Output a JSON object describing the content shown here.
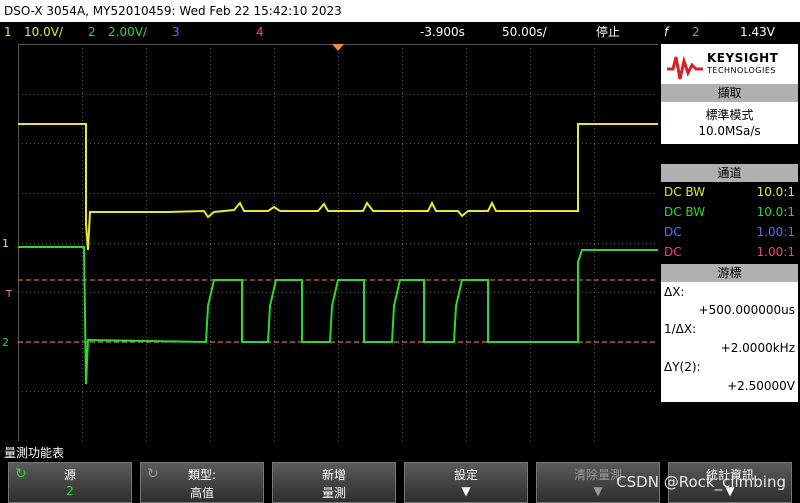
{
  "title": "DSO-X 3054A, MY52010459: Wed Feb 22 15:42:10 2023",
  "status": {
    "ch1_num": "1",
    "ch1_scale": "10.0V/",
    "ch2_num": "2",
    "ch2_scale": "2.00V/",
    "ch3_num": "3",
    "ch4_num": "4",
    "time_offset": "-3.900s",
    "time_scale": "50.00s/",
    "run_state": "停止",
    "trigger_slope": "f",
    "trigger_channel": "2",
    "trigger_level": "1.43V"
  },
  "logo": {
    "brand": "KEYSIGHT",
    "sub": "TECHNOLOGIES"
  },
  "acquire": {
    "header": "擷取",
    "mode": "標準模式",
    "rate": "10.0MSa/s"
  },
  "channels": {
    "header": "通道",
    "rows": [
      {
        "coupling": "DC BW",
        "ratio": "10.0:1"
      },
      {
        "coupling": "DC BW",
        "ratio": "10.0:1"
      },
      {
        "coupling": "DC",
        "ratio": "1.00:1"
      },
      {
        "coupling": "DC",
        "ratio": "1.00:1"
      }
    ]
  },
  "cursors": {
    "header": "游標",
    "dx_label": "ΔX:",
    "dx_value": "+500.000000us",
    "inv_label": "1/ΔX:",
    "inv_value": "+2.0000kHz",
    "dy_label": "ΔY(2):",
    "dy_value": "+2.50000V"
  },
  "markers": {
    "ch1": "1",
    "trig": "T",
    "ch2": "2"
  },
  "menu_title": "量測功能表",
  "softkeys": [
    {
      "line1": "源",
      "line2": "2"
    },
    {
      "line1": "類型:",
      "line2": "高值"
    },
    {
      "line1": "新增",
      "line2": "量測"
    },
    {
      "line1": "設定",
      "line2": ""
    },
    {
      "line1": "清除量測",
      "line2": ""
    },
    {
      "line1": "統計資訊",
      "line2": ""
    }
  ],
  "watermark": "CSDN @Rock_climbing",
  "colors": {
    "ch1": "#e8e830",
    "ch2": "#2ed82e",
    "ch3": "#5a6cff",
    "ch4": "#ff3f6c",
    "cursor": "#e8903a",
    "grid": "#555555"
  }
}
